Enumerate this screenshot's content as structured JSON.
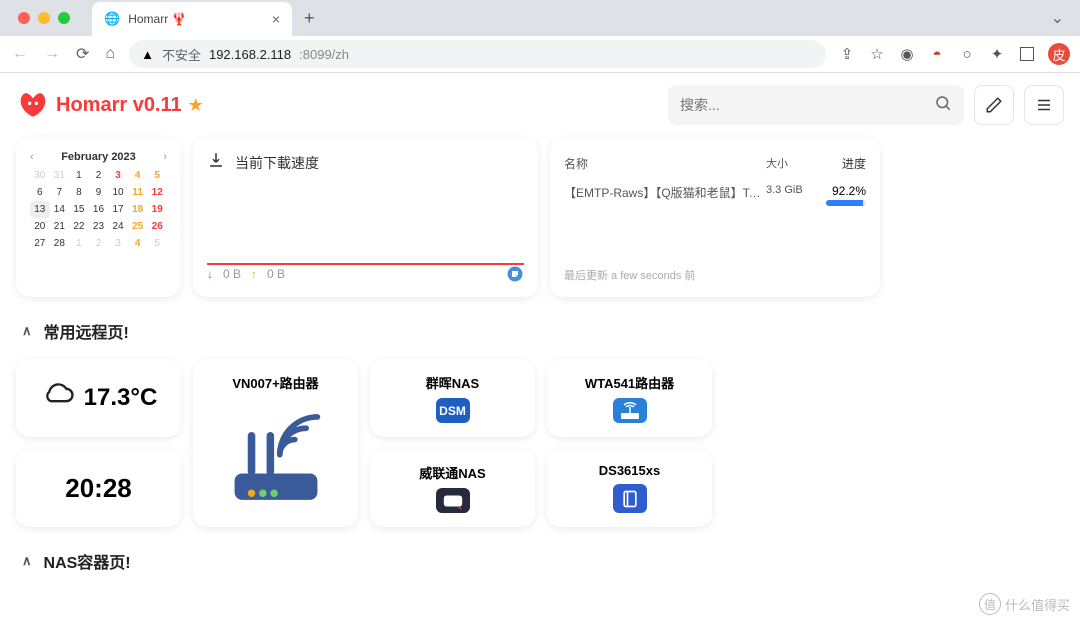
{
  "browser": {
    "tab_title": "Homarr 🦞",
    "insecure_label": "不安全",
    "url_host": "192.168.2.118",
    "url_rest": ":8099/zh",
    "profile_initial": "皮"
  },
  "header": {
    "app_title": "Homarr v0.11",
    "search_placeholder": "搜索..."
  },
  "calendar": {
    "title": "February 2023",
    "weeks": [
      [
        {
          "v": "30",
          "c": "dim"
        },
        {
          "v": "31",
          "c": "dim"
        },
        {
          "v": "1",
          "c": ""
        },
        {
          "v": "2",
          "c": ""
        },
        {
          "v": "3",
          "c": "red"
        },
        {
          "v": "4",
          "c": "yellow"
        },
        {
          "v": "5",
          "c": "yellow"
        }
      ],
      [
        {
          "v": "6",
          "c": ""
        },
        {
          "v": "7",
          "c": ""
        },
        {
          "v": "8",
          "c": ""
        },
        {
          "v": "9",
          "c": ""
        },
        {
          "v": "10",
          "c": ""
        },
        {
          "v": "11",
          "c": "yellow"
        },
        {
          "v": "12",
          "c": "red"
        }
      ],
      [
        {
          "v": "13",
          "c": "today"
        },
        {
          "v": "14",
          "c": ""
        },
        {
          "v": "15",
          "c": ""
        },
        {
          "v": "16",
          "c": ""
        },
        {
          "v": "17",
          "c": ""
        },
        {
          "v": "18",
          "c": "yellow"
        },
        {
          "v": "19",
          "c": "red"
        }
      ],
      [
        {
          "v": "20",
          "c": ""
        },
        {
          "v": "21",
          "c": ""
        },
        {
          "v": "22",
          "c": ""
        },
        {
          "v": "23",
          "c": ""
        },
        {
          "v": "24",
          "c": ""
        },
        {
          "v": "25",
          "c": "yellow"
        },
        {
          "v": "26",
          "c": "red"
        }
      ],
      [
        {
          "v": "27",
          "c": ""
        },
        {
          "v": "28",
          "c": ""
        },
        {
          "v": "1",
          "c": "dim"
        },
        {
          "v": "2",
          "c": "dim"
        },
        {
          "v": "3",
          "c": "dim"
        },
        {
          "v": "4",
          "c": "dim yellow"
        },
        {
          "v": "5",
          "c": "dim"
        }
      ]
    ]
  },
  "download": {
    "title": "当前下載速度",
    "down_value": "0 B",
    "up_value": "0 B"
  },
  "torrents": {
    "col_name": "名称",
    "col_size": "大小",
    "col_progress": "进度",
    "items": [
      {
        "name": "【EMTP-Raws】【Q版猫和老鼠】Tom & Jerry Kid...",
        "size": "3.3 GiB",
        "progress_label": "92.2%",
        "progress_pct": 92.2
      }
    ],
    "footer": "最后更新 a few seconds 前"
  },
  "sections": {
    "remote_title": "常用远程页!",
    "nas_title": "NAS容器页!"
  },
  "weather": {
    "temp": "17.3°C"
  },
  "clock": {
    "time": "20:28"
  },
  "services": {
    "router": "VN007+路由器",
    "synology": "群晖NAS",
    "wta": "WTA541路由器",
    "qnap": "威联通NAS",
    "xpenology": "DS3615xs"
  },
  "watermark": "什么值得买",
  "watermark_badge": "值"
}
